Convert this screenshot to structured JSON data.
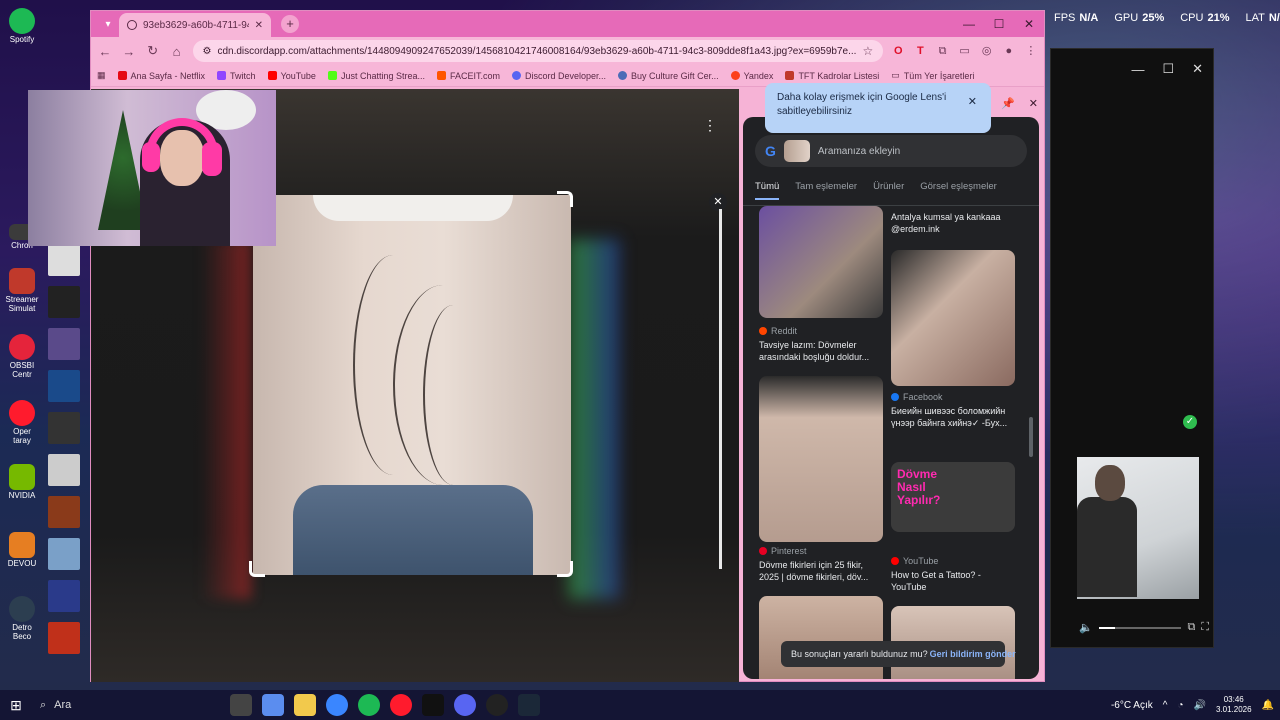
{
  "hud": {
    "fps_label": "FPS",
    "fps_value": "N/A",
    "gpu_label": "GPU",
    "gpu_value": "25%",
    "cpu_label": "CPU",
    "cpu_value": "21%",
    "lat_label": "LAT",
    "lat_value": "N/A"
  },
  "desktop": {
    "icons": [
      {
        "label": "Spotify",
        "color": "#1db954"
      },
      {
        "label": "Chron",
        "color": "#3b3b3b"
      },
      {
        "label": "Streamer Simulat",
        "color": "#c0392b"
      },
      {
        "label": "OBSBI Centr",
        "color": "#e5243b"
      },
      {
        "label": "Oper taray",
        "color": "#ff1b2d"
      },
      {
        "label": "NVIDIA",
        "color": "#76b900"
      },
      {
        "label": "DEVOU",
        "color": "#e67e22"
      },
      {
        "label": "Detro Beco",
        "color": "#2c3e50"
      }
    ]
  },
  "browser": {
    "tab_title": "93eb3629-a60b-4711-94c3-80",
    "new_tab_label": "+",
    "url": "cdn.discordapp.com/attachments/1448094909247652039/1456810421746008164/93eb3629-a60b-4711-94c3-809dde8f1a43.jpg?ex=6959b7e...",
    "bookmarks": [
      {
        "label": "Ana Sayfa - Netflix",
        "color": "#e50914"
      },
      {
        "label": "Twitch",
        "color": "#9146ff"
      },
      {
        "label": "YouTube",
        "color": "#ff0000"
      },
      {
        "label": "Just Chatting Strea...",
        "color": "#53fc18"
      },
      {
        "label": "FACEIT.com",
        "color": "#ff5500"
      },
      {
        "label": "Discord Developer...",
        "color": "#5865f2"
      },
      {
        "label": "Buy Culture Gift Cer...",
        "color": "#4b6cb7"
      },
      {
        "label": "Yandex",
        "color": "#fc3f1d"
      },
      {
        "label": "TFT Kadrolar Listesi",
        "color": "#c0392b"
      }
    ],
    "bookmarks_all_label": "Tüm Yer İşaretleri"
  },
  "lens": {
    "tooltip": "Daha kolay erişmek için Google Lens'i sabitleyebilirsiniz",
    "search_placeholder": "Aramanıza ekleyin",
    "tabs": [
      "Tümü",
      "Tam eşlemeler",
      "Ürünler",
      "Görsel eşleşmeler"
    ],
    "results": [
      {
        "source": "Reddit",
        "title": "Tavsiye lazım: Dövmeler arasındaki boşluğu doldur...",
        "dot": "#ff4500"
      },
      {
        "source": "",
        "title": "Antalya kumsal ya kankaaa @erdem.ink",
        "dot": ""
      },
      {
        "source": "Facebook",
        "title": "Биеийн шивээс боломжийн үнээр байнга хийнэ✓ -Бух...",
        "dot": "#1877f2"
      },
      {
        "source": "Pinterest",
        "title": "Dövme fikirleri için 25 fikir, 2025 | dövme fikirleri, döv...",
        "dot": "#e60023"
      },
      {
        "source": "YouTube",
        "title": "How to Get a Tattoo? - YouTube",
        "dot": "#ff0000"
      }
    ],
    "yt_thumb_text": "Dövme Nasıl Yapılır?",
    "feedback_text": "Bu sonuçları yararlı buldunuz mu?",
    "feedback_link": "Geri bildirim gönder"
  },
  "taskbar": {
    "search_label": "Ara",
    "weather": "-6°C  Açık",
    "time": "03:46",
    "date": "3.01.2026"
  }
}
